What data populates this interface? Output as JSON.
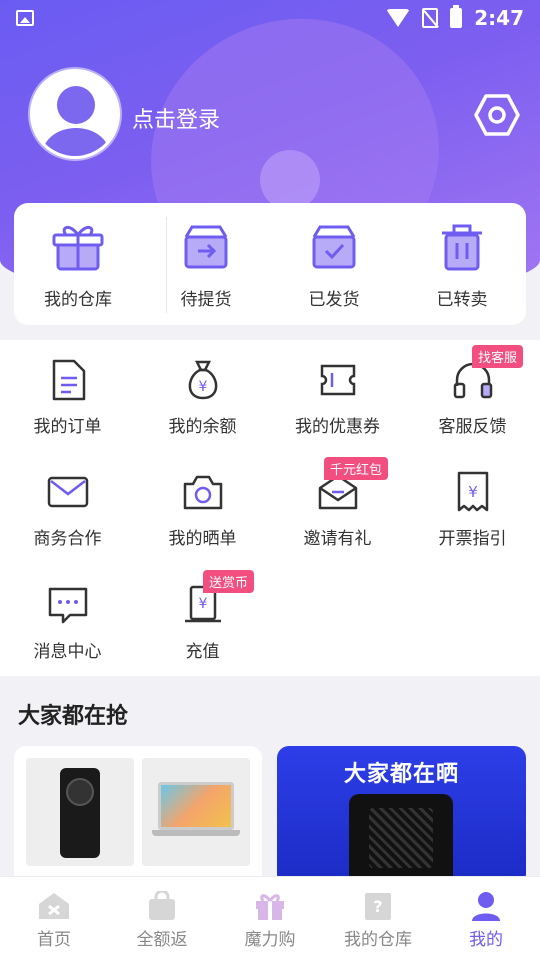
{
  "status_bar": {
    "time": "2:47"
  },
  "profile": {
    "login_text": "点击登录"
  },
  "warehouse": {
    "items": [
      {
        "label": "我的仓库",
        "icon": "gift-icon"
      },
      {
        "label": "待提货",
        "icon": "box-arrow-icon"
      },
      {
        "label": "已发货",
        "icon": "box-check-icon"
      },
      {
        "label": "已转卖",
        "icon": "trash-icon"
      }
    ]
  },
  "services": {
    "items": [
      {
        "label": "我的订单",
        "icon": "document-icon"
      },
      {
        "label": "我的余额",
        "icon": "money-bag-icon"
      },
      {
        "label": "我的优惠券",
        "icon": "coupon-icon"
      },
      {
        "label": "客服反馈",
        "icon": "headset-icon",
        "tag": "找客服"
      },
      {
        "label": "商务合作",
        "icon": "mail-icon"
      },
      {
        "label": "我的晒单",
        "icon": "camera-icon"
      },
      {
        "label": "邀请有礼",
        "icon": "envelope-open-icon",
        "tag": "千元红包"
      },
      {
        "label": "开票指引",
        "icon": "invoice-icon"
      },
      {
        "label": "消息中心",
        "icon": "chat-bubble-icon"
      },
      {
        "label": "充值",
        "icon": "recharge-icon",
        "tag": "送赏币"
      }
    ]
  },
  "section": {
    "title": "大家都在抢",
    "banner_text": "大家都在晒"
  },
  "tabbar": {
    "items": [
      {
        "label": "首页",
        "icon": "home-icon"
      },
      {
        "label": "全额返",
        "icon": "bag-icon"
      },
      {
        "label": "魔力购",
        "icon": "gift-box-icon"
      },
      {
        "label": "我的仓库",
        "icon": "warehouse-icon"
      },
      {
        "label": "我的",
        "icon": "person-icon",
        "active": true
      }
    ]
  },
  "colors": {
    "accent": "#6f5cf0",
    "tag": "#f24e7f",
    "icon_fill": "#b7aaf7"
  }
}
